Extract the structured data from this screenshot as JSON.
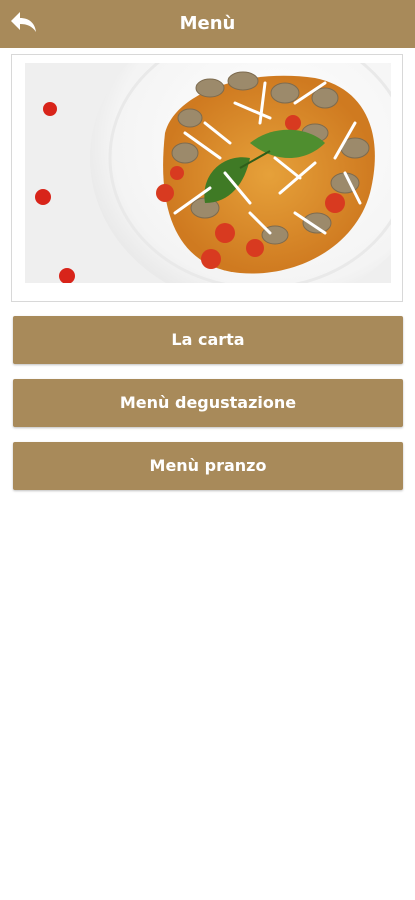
{
  "header": {
    "title": "Menù",
    "back_icon": "back-arrow-icon",
    "bg_color": "#a88a5a"
  },
  "menu": {
    "items": [
      {
        "label": "La carta"
      },
      {
        "label": "Menù degustazione"
      },
      {
        "label": "Menù pranzo"
      }
    ]
  }
}
